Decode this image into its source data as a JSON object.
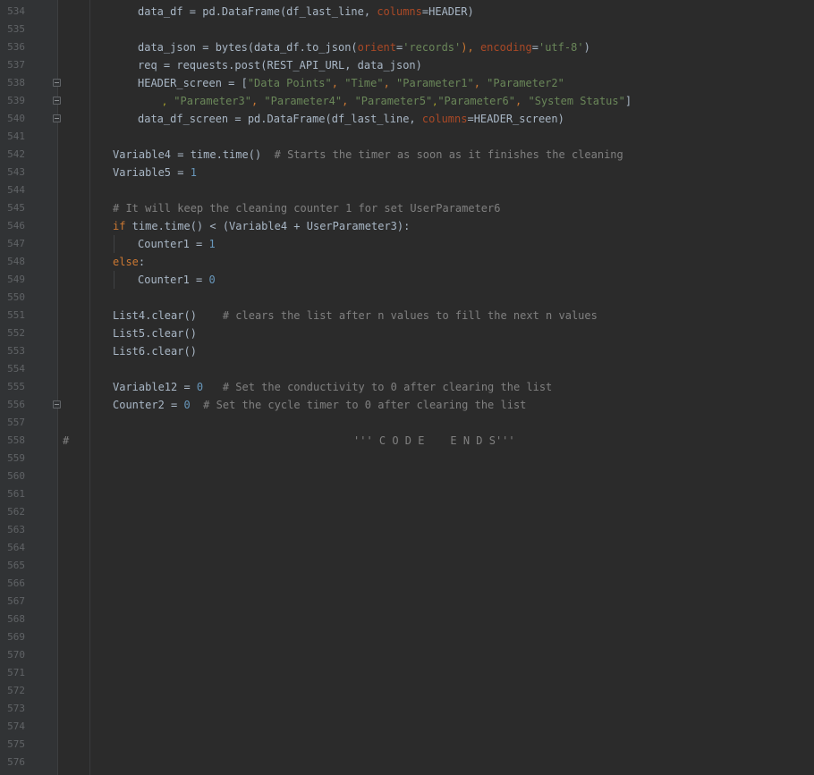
{
  "editor": {
    "line_numbers": [
      "534",
      "535",
      "536",
      "537",
      "538",
      "539",
      "540",
      "541",
      "542",
      "543",
      "544",
      "545",
      "546",
      "547",
      "548",
      "549",
      "550",
      "551",
      "552",
      "553",
      "554",
      "555",
      "556",
      "557",
      "558",
      "559",
      "560",
      "561",
      "562",
      "563",
      "564",
      "565",
      "566",
      "567",
      "568",
      "569",
      "570",
      "571",
      "572",
      "573",
      "574",
      "575",
      "576"
    ],
    "fold_lines": [
      "538",
      "539",
      "540",
      "556"
    ],
    "lines": {
      "l534": {
        "a": "data_df = pd.DataFrame(df_last_line, ",
        "b": "columns",
        "c": "=HEADER)"
      },
      "l536": {
        "a": "data_json = bytes(data_df.to_json(",
        "b": "orient",
        "c": "=",
        "d": "'records'",
        "e": "), ",
        "f": "encoding",
        "g": "=",
        "h": "'utf-8'",
        "i": ")"
      },
      "l537": {
        "a": "req = requests.post(REST_API_URL, data_json)"
      },
      "l538": {
        "a": "HEADER_screen = [",
        "b": "\"Data Points\"",
        "c": ", ",
        "d": "\"Time\"",
        "e": ", ",
        "f": "\"Parameter1\"",
        "g": ", ",
        "h": "\"Parameter2\""
      },
      "l539": {
        "a": "\"Parameter3\"",
        "b": ", ",
        "c": "\"Parameter4\"",
        "d": ", ",
        "e": "\"Parameter5\"",
        "f": "\"Parameter6\"",
        "g": ", ",
        "h": "\"System Status\"",
        "i": "]",
        "w1": "ʿ,",
        "w2": ","
      },
      "l540": {
        "a": "data_df_screen = pd.DataFrame(df_last_line, ",
        "b": "columns",
        "c": "=HEADER_screen)"
      },
      "l542": {
        "a": "Variable4 = time.time()  ",
        "b": "# Starts the timer as soon as it finishes the cleaning"
      },
      "l543": {
        "a": "Variable5 = ",
        "b": "1"
      },
      "l545": {
        "a": "# It will keep the cleaning counter 1 for set UserParameter6"
      },
      "l546": {
        "a": "if",
        "b": " time.time() < (Variable4 + UserParameter3):"
      },
      "l547": {
        "a": "Counter1 = ",
        "b": "1"
      },
      "l548": {
        "a": "else",
        ":": ":"
      },
      "l549": {
        "a": "Counter1 = ",
        "b": "0"
      },
      "l551": {
        "a": "List4.clear()    ",
        "b": "# clears the list after n values to fill the next n values"
      },
      "l552": {
        "a": "List5.clear()"
      },
      "l553": {
        "a": "List6.clear()"
      },
      "l555": {
        "a": "Variable12 = ",
        "b": "0",
        "c": "   # Set the conductivity to 0 after clearing the list"
      },
      "l556": {
        "a": "Counter2 = ",
        "b": "0",
        "c": "  # Set the cycle timer to 0 after clearing the list"
      },
      "l558": {
        "a": "#",
        "b": "''' C O D E    E N D S'''"
      }
    }
  }
}
